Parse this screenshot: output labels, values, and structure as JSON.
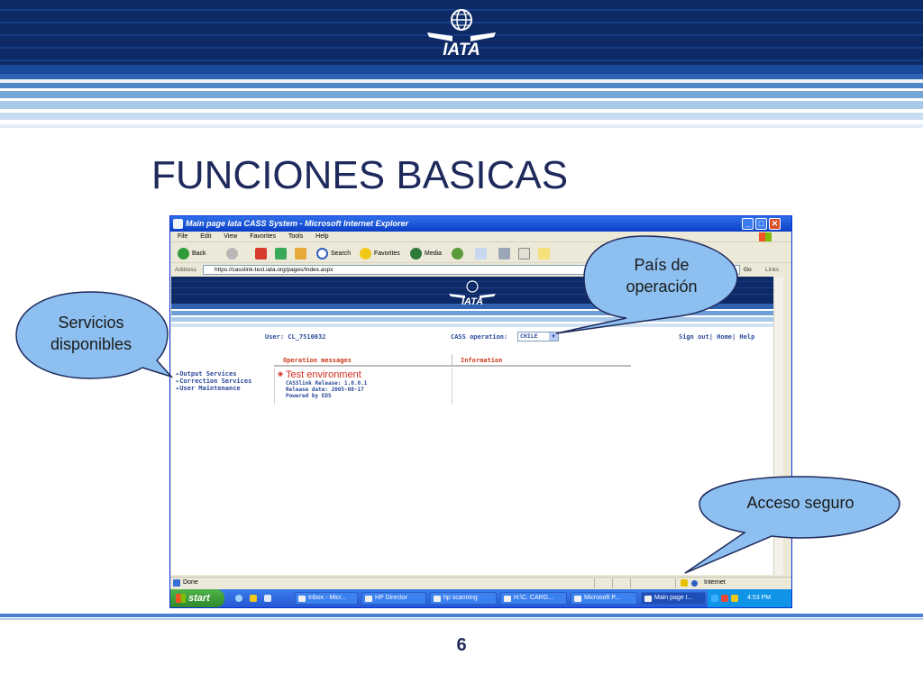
{
  "slide": {
    "title": "FUNCIONES BASICAS",
    "page_number": "6",
    "brand": "IATA"
  },
  "callouts": {
    "pais": "País de operación",
    "servicios": "Servicios disponibles",
    "acceso": "Acceso seguro"
  },
  "browser": {
    "title": "Main page Iata CASS System - Microsoft Internet Explorer",
    "menu": [
      "File",
      "Edit",
      "View",
      "Favorites",
      "Tools",
      "Help"
    ],
    "toolbar": {
      "back": "Back",
      "search": "Search",
      "favorites": "Favorites",
      "media": "Media"
    },
    "address_label": "Address",
    "address_url": "https://casslink-test.iata.org/pages/Index.aspx",
    "go": "Go",
    "links": "Links",
    "status_text": "Done",
    "zone": "Internet"
  },
  "page": {
    "brand": "IATA",
    "user": "User: CL_7510032",
    "cass_label": "CASS operation:",
    "cass_value": "CHILE",
    "sign_links": "Sign out| Home| Help",
    "tabs": {
      "operation": "Operation messages",
      "information": "Information"
    },
    "services": [
      "Output Services",
      "Correction Services",
      "User Maintenance"
    ],
    "environment": {
      "title": "Test environment",
      "lines": [
        "CASSlink Release: 1.0.0.1",
        "Release date: 2005-08-17",
        "Powered by EDS"
      ]
    }
  },
  "taskbar": {
    "start": "start",
    "tasks": [
      "Inbox - Micr...",
      "HP Director",
      "hp scanning",
      "H:\\C. CARG...",
      "Microsoft P...",
      "Main page I..."
    ],
    "clock": "4:53 PM"
  },
  "colors": {
    "banner_dark": "#0d2a66",
    "title_navy": "#1f2a5c",
    "callout_fill": "#8dc0f0",
    "accent_red": "#d12a1a"
  }
}
